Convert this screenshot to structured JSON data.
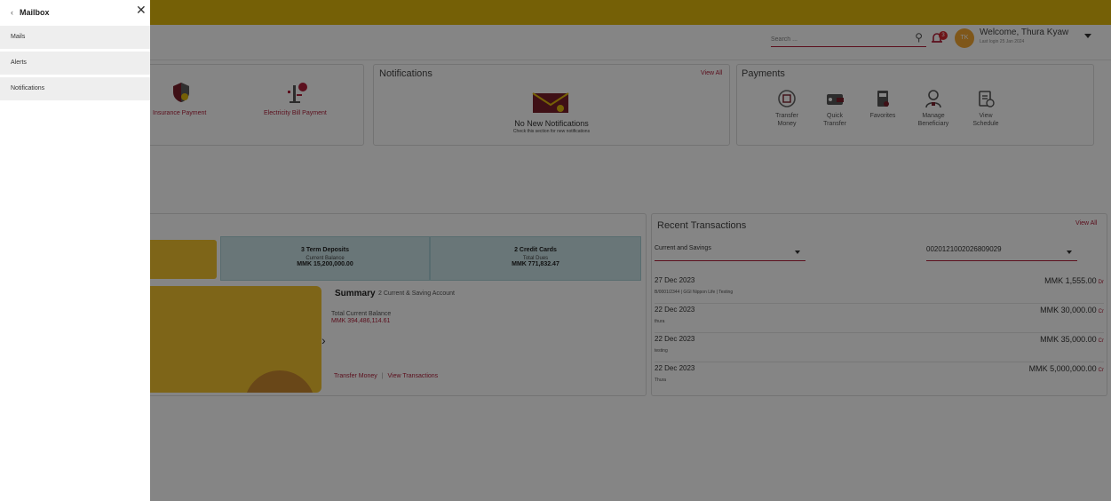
{
  "header": {
    "search_placeholder": "Search ...",
    "notification_count": "3",
    "avatar_initials": "TK",
    "welcome_text": "Welcome, Thura Kyaw",
    "last_login": "Last login 25 Jan 2024"
  },
  "quick_links": [
    {
      "label": "Insurance Payment",
      "icon": "insurance-shield-icon"
    },
    {
      "label": "Electricity Bill Payment",
      "icon": "electricity-bill-icon"
    }
  ],
  "notifications": {
    "title": "Notifications",
    "view_all": "View All",
    "empty_title": "No New Notifications",
    "empty_sub": "Check this section for new notifications"
  },
  "payments": {
    "title": "Payments",
    "items": [
      {
        "label": "Transfer\nMoney",
        "icon": "transfer-money-icon"
      },
      {
        "label": "Quick\nTransfer",
        "icon": "quick-transfer-icon"
      },
      {
        "label": "Favorites",
        "icon": "favorites-icon"
      },
      {
        "label": "Manage\nBeneficiary",
        "icon": "beneficiary-icon"
      },
      {
        "label": "View\nSchedule",
        "icon": "schedule-icon"
      }
    ]
  },
  "accounts": {
    "cells": [
      {
        "title": "3 Term Deposits",
        "sub": "Current Balance",
        "value": "MMK 15,200,000.00"
      },
      {
        "title": "2 Credit Cards",
        "sub": "Total Dues",
        "value": "MMK 771,832.47"
      }
    ],
    "summary_title": "Summary",
    "summary_sub": "2 Current & Saving Account",
    "total_label": "Total Current Balance",
    "total_value": "MMK 394,486,114.61",
    "link_transfer": "Transfer Money",
    "link_separator": "|",
    "link_view": "View Transactions",
    "next_arrow": "›"
  },
  "recent_transactions": {
    "title": "Recent Transactions",
    "view_all": "View All",
    "account_type": "Current and Savings",
    "account_number": "0020121002026809029",
    "rows": [
      {
        "date": "27 Dec 2023",
        "desc": "B/0001/2344 | GGI Nippon Life | Testing",
        "amount": "MMK 1,555.00",
        "type": "Dr"
      },
      {
        "date": "22 Dec 2023",
        "desc": "thura",
        "amount": "MMK 30,000.00",
        "type": "Cr"
      },
      {
        "date": "22 Dec 2023",
        "desc": "testing",
        "amount": "MMK 35,000.00",
        "type": "Cr"
      },
      {
        "date": "22 Dec 2023",
        "desc": "Thura",
        "amount": "MMK 5,000,000.00",
        "type": "Cr"
      }
    ]
  },
  "drawer": {
    "back_symbol": "‹",
    "title": "Mailbox",
    "close_symbol": "✕",
    "items": [
      {
        "label": "Mails"
      },
      {
        "label": "Alerts"
      },
      {
        "label": "Notifications"
      }
    ]
  },
  "colors": {
    "brand_yellow": "#e0b90c",
    "accent_red": "#b0203a",
    "account_teal": "#c9e3e7",
    "card_yellow": "#f2c12e"
  }
}
